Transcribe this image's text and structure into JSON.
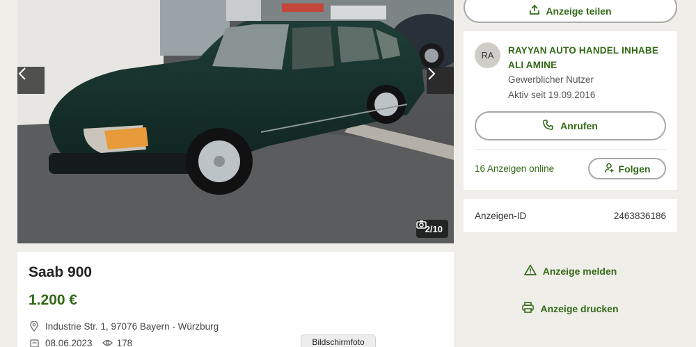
{
  "gallery": {
    "counter": "2/10",
    "icons": {
      "prev": "chevron-left-icon",
      "next": "chevron-right-icon",
      "camera": "camera-icon"
    }
  },
  "listing": {
    "title": "Saab 900",
    "price": "1.200 €",
    "location": "Industrie Str. 1, 97076 Bayern - Würzburg",
    "date": "08.06.2023",
    "views": "178"
  },
  "tooltip": "Bildschirmfoto",
  "share": {
    "label": "Anzeige teilen"
  },
  "seller": {
    "initials": "RA",
    "name": "RAYYAN AUTO HANDEL INHABE ALI AMINE",
    "type": "Gewerblicher Nutzer",
    "active_since": "Aktiv seit 19.09.2016",
    "call_label": "Anrufen",
    "ads_online": "16 Anzeigen online",
    "follow_label": "Folgen"
  },
  "ad_id": {
    "label": "Anzeigen-ID",
    "value": "2463836186"
  },
  "actions": {
    "report_label": "Anzeige melden",
    "print_label": "Anzeige drucken"
  },
  "colors": {
    "accent": "#326916",
    "background": "#efeee9",
    "border": "#a8a8a8"
  }
}
